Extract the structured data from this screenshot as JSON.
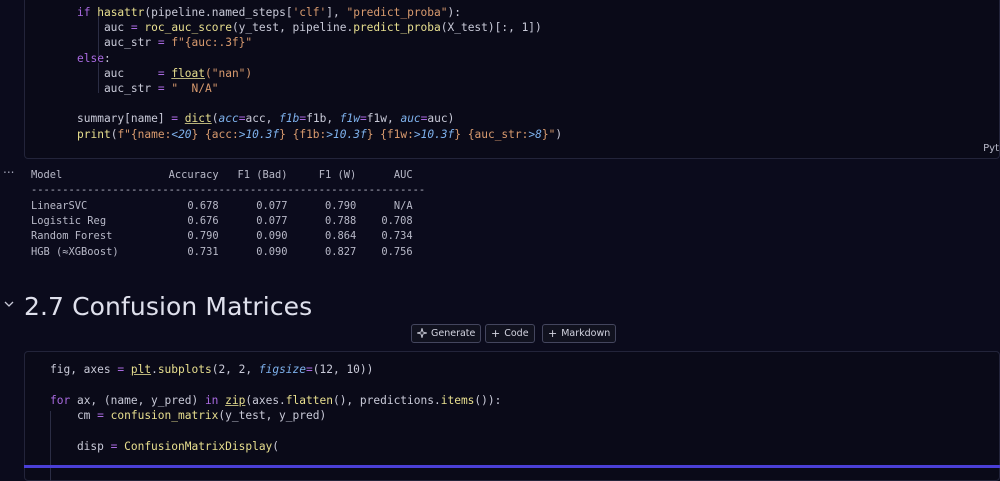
{
  "top_cell": {
    "language": "Pyt",
    "code_lines": [
      [
        [
          "kw",
          "if "
        ],
        [
          "fn",
          "hasattr"
        ],
        [
          "pl",
          "(pipeline.named_steps["
        ],
        [
          "st",
          "'clf'"
        ],
        [
          "pl",
          "], "
        ],
        [
          "st",
          "\"predict_proba\""
        ],
        [
          "pl",
          "):"
        ]
      ],
      [
        [
          "pl",
          "    auc "
        ],
        [
          "kw",
          "= "
        ],
        [
          "fn",
          "roc_auc_score"
        ],
        [
          "pl",
          "(y_test, pipeline."
        ],
        [
          "fn",
          "predict_proba"
        ],
        [
          "pl",
          "(X_test)[:, 1])"
        ]
      ],
      [
        [
          "pl",
          "    auc_str "
        ],
        [
          "kw",
          "= "
        ],
        [
          "st",
          "f\"{auc:.3f}\""
        ]
      ],
      [
        [
          "kw",
          "else"
        ],
        [
          "pl",
          ":"
        ]
      ],
      [
        [
          "pl",
          "    auc     "
        ],
        [
          "kw",
          "= "
        ],
        [
          "bi",
          "float"
        ],
        [
          "st",
          "(\"nan\")"
        ]
      ],
      [
        [
          "pl",
          "    auc_str "
        ],
        [
          "kw",
          "= "
        ],
        [
          "st",
          "\"  N/A\""
        ]
      ],
      [
        [
          "pl",
          ""
        ]
      ],
      [
        [
          "pl",
          "summary[name] "
        ],
        [
          "kw",
          "= "
        ],
        [
          "bi",
          "dict"
        ],
        [
          "pl",
          "("
        ],
        [
          "pa",
          "acc"
        ],
        [
          "kw",
          "="
        ],
        [
          "pl",
          "acc, "
        ],
        [
          "pa",
          "f1b"
        ],
        [
          "kw",
          "="
        ],
        [
          "pl",
          "f1b, "
        ],
        [
          "pa",
          "f1w"
        ],
        [
          "kw",
          "="
        ],
        [
          "pl",
          "f1w, "
        ],
        [
          "pa",
          "auc"
        ],
        [
          "kw",
          "="
        ],
        [
          "pl",
          "auc)"
        ]
      ],
      [
        [
          "fn",
          "print"
        ],
        [
          "pl",
          "("
        ],
        [
          "st",
          "f\"{name:"
        ],
        [
          "pa",
          "<20"
        ],
        [
          "st",
          "} {acc:"
        ],
        [
          "pa",
          ">10.3f"
        ],
        [
          "st",
          "} {f1b:"
        ],
        [
          "pa",
          ">10.3f"
        ],
        [
          "st",
          "} {f1w:"
        ],
        [
          "pa",
          ">10.3f"
        ],
        [
          "st",
          "} {auc_str:"
        ],
        [
          "pa",
          ">8"
        ],
        [
          "st",
          "}\""
        ],
        [
          "pl",
          ")"
        ]
      ]
    ]
  },
  "output": {
    "dots": "...",
    "lines": [
      "Model                 Accuracy   F1 (Bad)     F1 (W)      AUC",
      "---------------------------------------------------------------",
      "LinearSVC                0.678      0.077      0.790      N/A",
      "Logistic Reg             0.676      0.077      0.788    0.708",
      "Random Forest            0.790      0.090      0.864    0.734",
      "HGB (≈XGBoost)           0.731      0.090      0.827    0.756"
    ]
  },
  "section": {
    "heading": "2.7 Confusion Matrices"
  },
  "toolbar": {
    "generate_icon": "sparkle-icon",
    "generate_label": "Generate",
    "code_icon": "plus-icon",
    "code_label": "Code",
    "markdown_icon": "plus-icon",
    "markdown_label": "Markdown"
  },
  "bottom_cell": {
    "code_lines": [
      [
        [
          "pl",
          "fig, axes "
        ],
        [
          "kw",
          "= "
        ],
        [
          "bi",
          "plt"
        ],
        [
          "pl",
          "."
        ],
        [
          "fn",
          "subplots"
        ],
        [
          "pl",
          "(2, 2, "
        ],
        [
          "pa",
          "figsize"
        ],
        [
          "kw",
          "="
        ],
        [
          "pl",
          "(12, 10))"
        ]
      ],
      [
        [
          "pl",
          ""
        ]
      ],
      [
        [
          "kw",
          "for "
        ],
        [
          "pl",
          "ax, (name, y_pred) "
        ],
        [
          "kw",
          "in "
        ],
        [
          "bi",
          "zip"
        ],
        [
          "pl",
          "(axes."
        ],
        [
          "fn",
          "flatten"
        ],
        [
          "pl",
          "(), predictions."
        ],
        [
          "fn",
          "items"
        ],
        [
          "pl",
          "()):"
        ]
      ],
      [
        [
          "pl",
          "    cm "
        ],
        [
          "kw",
          "= "
        ],
        [
          "fn",
          "confusion_matrix"
        ],
        [
          "pl",
          "(y_test, y_pred)"
        ]
      ],
      [
        [
          "pl",
          ""
        ]
      ],
      [
        [
          "pl",
          "    disp "
        ],
        [
          "kw",
          "= "
        ],
        [
          "fn",
          "ConfusionMatrixDisplay"
        ],
        [
          "pl",
          "("
        ]
      ]
    ]
  },
  "colors": {
    "background": "#0b0b1c",
    "keyword": "#a96ae0",
    "function": "#e8df8f",
    "string": "#d89a6e",
    "parameter": "#7eb1ec",
    "status_bar": "#4a3fd6"
  }
}
